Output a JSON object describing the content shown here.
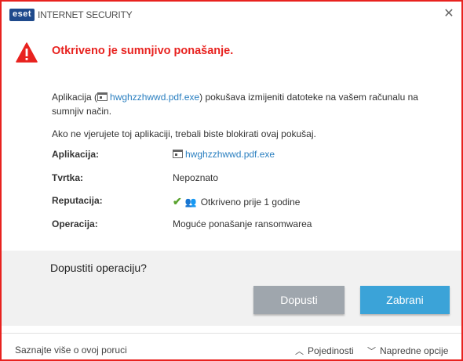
{
  "brand": {
    "logo_text": "eset",
    "product": "INTERNET SECURITY",
    "accent": "#e8221f",
    "link_color": "#2a7fc0"
  },
  "heading": "Otkriveno je sumnjivo ponašanje.",
  "description": {
    "prefix": "Aplikacija (",
    "app_name": "hwghzzhwwd.pdf.exe",
    "suffix": ") pokušava izmijeniti datoteke na vašem računalu na sumnjiv način.",
    "line2": "Ako ne vjerujete toj aplikaciji, trebali biste blokirati ovaj pokušaj."
  },
  "details": {
    "app_label": "Aplikacija:",
    "app_value": "hwghzzhwwd.pdf.exe",
    "company_label": "Tvrtka:",
    "company_value": "Nepoznato",
    "reputation_label": "Reputacija:",
    "reputation_value": "Otkriveno prije 1 godine",
    "operation_label": "Operacija:",
    "operation_value": "Moguće ponašanje ransomwarea"
  },
  "question": "Dopustiti operaciju?",
  "buttons": {
    "allow": "Dopusti",
    "block": "Zabrani",
    "allow_color": "#9fa6ad",
    "block_color": "#3ba3d8"
  },
  "footer": {
    "learn_more": "Saznajte više o ovoj poruci",
    "details": "Pojedinosti",
    "advanced": "Napredne opcije"
  }
}
